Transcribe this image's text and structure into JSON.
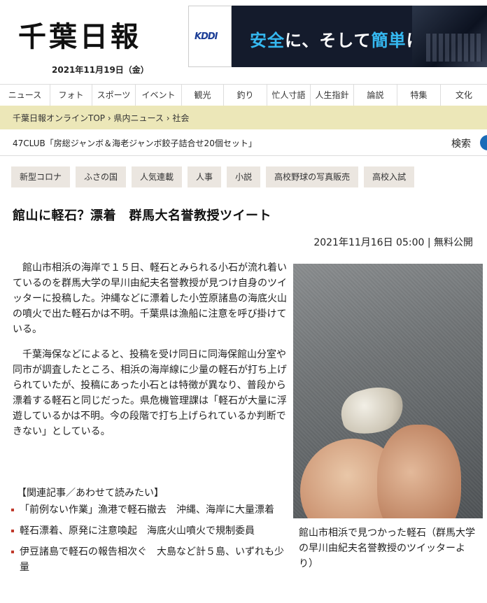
{
  "header": {
    "logo": "千葉日報",
    "date": "2021年11月19日（金）"
  },
  "ad": {
    "brand": "KDDI",
    "copy_part1": "安全",
    "copy_part2": "に、そして",
    "copy_part3": "簡単",
    "copy_part4": "に"
  },
  "nav": {
    "items": [
      "ニュース",
      "フォト",
      "スポーツ",
      "イベント",
      "観光",
      "釣り",
      "忙人寸語",
      "人生指針",
      "論説",
      "特集",
      "文化"
    ]
  },
  "breadcrumb": {
    "home": "千葉日報オンラインTOP",
    "section": "県内ニュース",
    "current": "社会",
    "separator": "›"
  },
  "ticker": {
    "text": "47CLUB「房総ジャンボ＆海老ジャンボ餃子詰合せ20個セット」",
    "search_label": "検索"
  },
  "tags": [
    "新型コロナ",
    "ふさの国",
    "人気連載",
    "人事",
    "小説",
    "高校野球の写真販売",
    "高校入試"
  ],
  "article": {
    "title": "館山に軽石？漂着　群馬大名誉教授ツイート",
    "byline": "2021年11月16日 05:00 | 無料公開",
    "paragraphs": [
      "館山市相浜の海岸で１５日、軽石とみられる小石が流れ着いているのを群馬大学の早川由紀夫名誉教授が見つけ自身のツイッターに投稿した。沖縄などに漂着した小笠原諸島の海底火山の噴火で出た軽石かは不明。千葉県は漁船に注意を呼び掛けている。",
      "千葉海保などによると、投稿を受け同日に同海保館山分室や同市が調査したところ、相浜の海岸線に少量の軽石が打ち上げられていたが、投稿にあった小石とは特徴が異なり、普段から漂着する軽石と同じだった。県危機管理課は「軽石が大量に浮遊しているかは不明。今の段階で打ち上げられているか判断できない」としている。"
    ],
    "photo_caption": "館山市相浜で見つかった軽石（群馬大学の早川由紀夫名誉教授のツイッターより）"
  },
  "related": {
    "heading": "【関連記事／あわせて読みたい】",
    "items": [
      "「前例ない作業」漁港で軽石撤去　沖縄、海岸に大量漂着",
      "軽石漂着、原発に注意喚起　海底火山噴火で規制委員",
      "伊豆諸島で軽石の報告相次ぐ　大島など計５島、いずれも少量"
    ]
  },
  "colors": {
    "breadcrumb_bg": "#ece7b8",
    "tag_bg": "#ebe6e0",
    "ad_accent": "#35b8f0",
    "bullet": "#c0392b"
  }
}
